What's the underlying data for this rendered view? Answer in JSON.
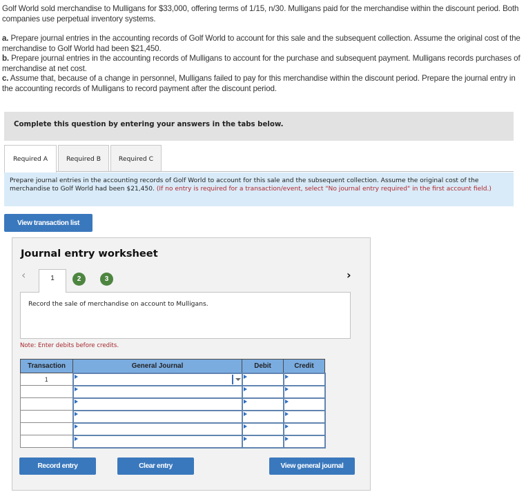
{
  "problem": {
    "intro": "Golf World sold merchandise to Mulligans for $33,000, offering terms of 1/15, n/30. Mulligans paid for the merchandise within the discount period. Both companies use perpetual inventory systems.",
    "parts": [
      {
        "label": "a.",
        "text": " Prepare journal entries in the accounting records of Golf World to account for this sale and the subsequent collection. Assume the original cost of the merchandise to Golf World had been $21,450."
      },
      {
        "label": "b.",
        "text": " Prepare journal entries in the accounting records of Mulligans to account for the purchase and subsequent payment. Mulligans records purchases of merchandise at net cost."
      },
      {
        "label": "c.",
        "text": " Assume that, because of a change in personnel, Mulligans failed to pay for this merchandise within the discount period. Prepare the journal entry in the accounting records of Mulligans to record payment after the discount period."
      }
    ]
  },
  "instruction_banner": "Complete this question by entering your answers in the tabs below.",
  "tabs": [
    {
      "label": "Required A",
      "active": true
    },
    {
      "label": "Required B",
      "active": false
    },
    {
      "label": "Required C",
      "active": false
    }
  ],
  "info": {
    "text": "Prepare journal entries in the accounting records of Golf World to account for this sale and the subsequent collection. Assume the original cost of the merchandise to Golf World had been $21,450.",
    "hint": "(If no entry is required for a transaction/event, select \"No journal entry required\" in the first account field.)"
  },
  "buttons": {
    "view_transaction_list": "View transaction list",
    "record_entry": "Record entry",
    "clear_entry": "Clear entry",
    "view_general_journal": "View general journal"
  },
  "worksheet": {
    "title": "Journal entry worksheet",
    "prev_icon": "chevron-left-icon",
    "next_icon": "chevron-right-icon",
    "steps": [
      "1",
      "2",
      "3"
    ],
    "current_step": "1",
    "description": "Record the sale of merchandise on account to Mulligans.",
    "note": "Note: Enter debits before credits.",
    "colors": {
      "completed_step": "#4d8540",
      "header": "#7aace0",
      "button": "#3a78bd"
    }
  },
  "journal_table": {
    "headers": [
      "Transaction",
      "General Journal",
      "Debit",
      "Credit"
    ],
    "rows": [
      {
        "transaction": "1",
        "account": "",
        "debit": "",
        "credit": ""
      },
      {
        "transaction": "",
        "account": "",
        "debit": "",
        "credit": ""
      },
      {
        "transaction": "",
        "account": "",
        "debit": "",
        "credit": ""
      },
      {
        "transaction": "",
        "account": "",
        "debit": "",
        "credit": ""
      },
      {
        "transaction": "",
        "account": "",
        "debit": "",
        "credit": ""
      },
      {
        "transaction": "",
        "account": "",
        "debit": "",
        "credit": ""
      }
    ]
  }
}
